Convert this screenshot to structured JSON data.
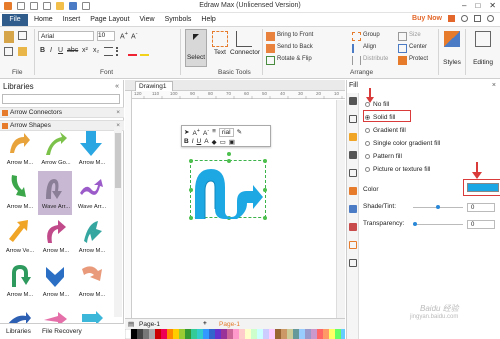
{
  "window": {
    "title": "Edraw Max (Unlicensed Version)",
    "controls": [
      "–",
      "□",
      "✕"
    ]
  },
  "menu": {
    "file": "File",
    "items": [
      "Home",
      "Insert",
      "Page Layout",
      "View",
      "Symbols",
      "Help"
    ],
    "buy_now": "Buy Now"
  },
  "ribbon": {
    "font_name": "Arial",
    "font_size": "10",
    "groups": {
      "file": "File",
      "font": "Font",
      "basic_tools": "Basic Tools",
      "arrange": "Arrange",
      "styles": "Styles",
      "editing": "Editing"
    },
    "tools": {
      "select": "Select",
      "text": "Text",
      "connector": "Connector"
    },
    "arrange": {
      "bring_to_front": "Bring to Front",
      "send_to_back": "Send to Back",
      "rotate_flip": "Rotate & Flip",
      "group": "Group",
      "align": "Align",
      "distribute": "Distribute",
      "size": "Size",
      "center": "Center",
      "protect": "Protect"
    }
  },
  "libraries": {
    "title": "Libraries",
    "sections": [
      "Arrow Connectors",
      "Arrow Shapes"
    ],
    "shapes": [
      {
        "label": "Arrow M..."
      },
      {
        "label": "Arrow Go..."
      },
      {
        "label": "Arrow M..."
      },
      {
        "label": "Arrow M..."
      },
      {
        "label": "Wave Arr..."
      },
      {
        "label": "Wave Arr..."
      },
      {
        "label": "Arrow Ve..."
      },
      {
        "label": "Arrow M..."
      },
      {
        "label": "Arrow M..."
      },
      {
        "label": "Arrow M..."
      },
      {
        "label": "Arrow M..."
      },
      {
        "label": "Arrow M..."
      }
    ],
    "tabs": [
      "Libraries",
      "File Recovery"
    ]
  },
  "document": {
    "tab": "Drawing1",
    "page_left": "Page-1",
    "page_right": "Page-1",
    "ruler_marks": [
      "120",
      "110",
      "100",
      "90",
      "80",
      "70",
      "60",
      "50",
      "40",
      "30",
      "20",
      "10"
    ],
    "float_font": "rial"
  },
  "fill_panel": {
    "title": "Fill",
    "options": [
      {
        "label": "No fill",
        "selected": false
      },
      {
        "label": "Solid fill",
        "selected": true
      },
      {
        "label": "Gradient fill",
        "selected": false
      },
      {
        "label": "Single color gradient fill",
        "selected": false
      },
      {
        "label": "Pattern fill",
        "selected": false
      },
      {
        "label": "Picture or texture fill",
        "selected": false
      }
    ],
    "color_label": "Color",
    "color_value": "#19a7e6",
    "shade_label": "Shade/Tint:",
    "shade_value": "0",
    "shade_level_pct": 50,
    "transparency_label": "Transparency:",
    "transparency_value": "0",
    "transparency_level_pct": 0,
    "unit": "%"
  },
  "watermark": {
    "line1": "Baidu 经验",
    "line2": "jingyan.baidu.com"
  }
}
